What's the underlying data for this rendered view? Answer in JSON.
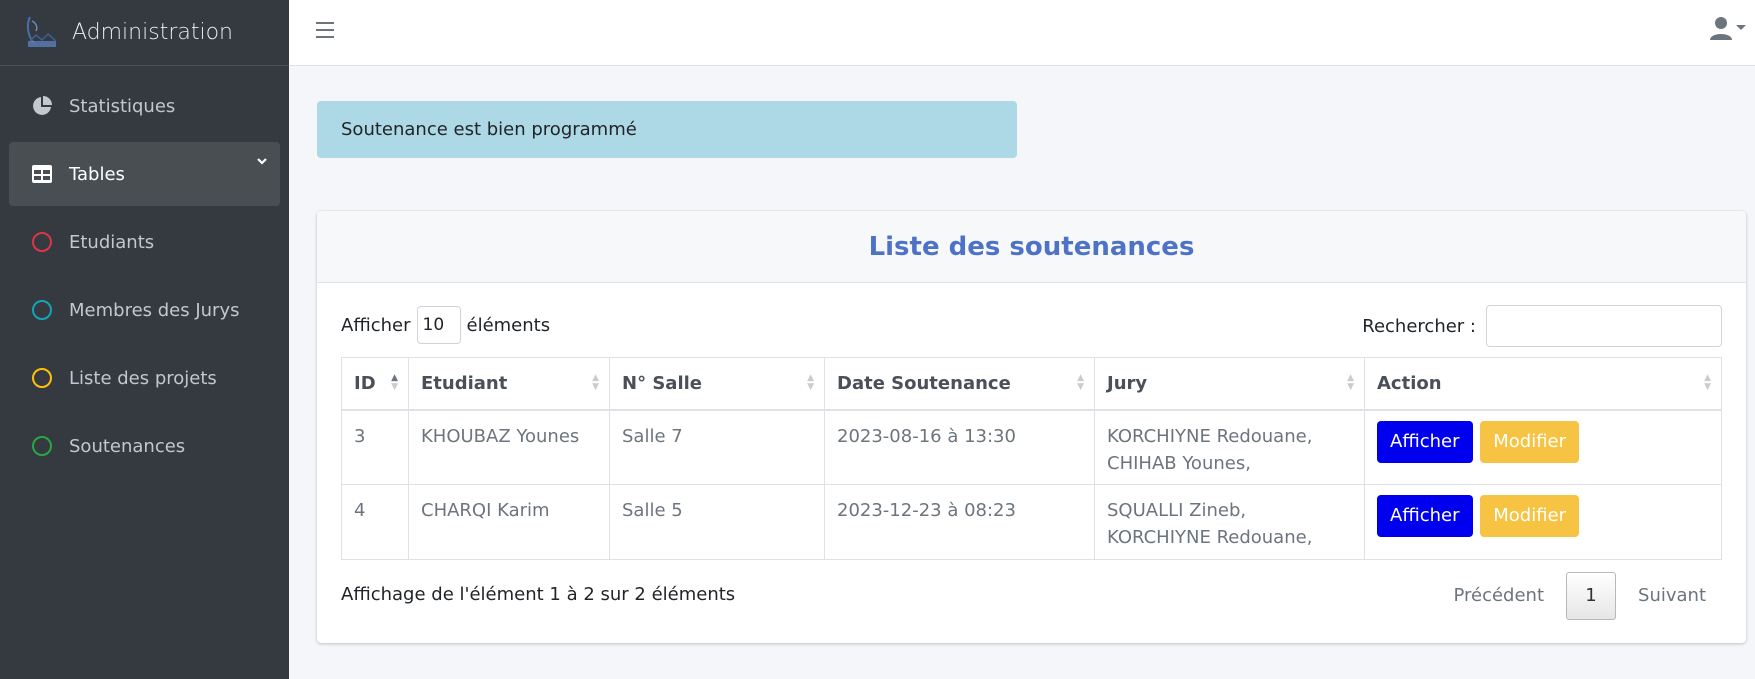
{
  "app": {
    "title": "Administration"
  },
  "sidebar": {
    "items": [
      {
        "label": "Statistiques",
        "icon": "pie-chart-icon"
      },
      {
        "label": "Tables",
        "icon": "table-icon",
        "active": true
      },
      {
        "label": "Etudiants",
        "icon": "circle-icon",
        "color": "#dc3545"
      },
      {
        "label": "Membres des Jurys",
        "icon": "circle-icon",
        "color": "#17a2b8"
      },
      {
        "label": "Liste des projets",
        "icon": "circle-icon",
        "color": "#ffc107"
      },
      {
        "label": "Soutenances",
        "icon": "circle-icon",
        "color": "#28a745"
      }
    ]
  },
  "alert": {
    "text": "Soutenance est bien programmé",
    "color": "#add8e6"
  },
  "card": {
    "title": "Liste des soutenances",
    "length": {
      "prefix": "Afficher",
      "value": "10",
      "suffix": "éléments"
    },
    "search": {
      "label": "Rechercher :",
      "value": ""
    },
    "columns": [
      "ID",
      "Etudiant",
      "N° Salle",
      "Date Soutenance",
      "Jury",
      "Action"
    ],
    "rows": [
      {
        "id": "3",
        "etudiant": "KHOUBAZ Younes",
        "salle": "Salle 7",
        "date": "2023-08-16 à 13:30",
        "jury1": "KORCHIYNE Redouane,",
        "jury2": "CHIHAB Younes,"
      },
      {
        "id": "4",
        "etudiant": "CHARQI Karim",
        "salle": "Salle 5",
        "date": "2023-12-23 à 08:23",
        "jury1": "SQUALLI Zineb,",
        "jury2": "KORCHIYNE Redouane,"
      }
    ],
    "buttons": {
      "show": "Afficher",
      "edit": "Modifier"
    },
    "info": "Affichage de l'élément 1 à 2 sur 2 éléments",
    "pager": {
      "prev": "Précédent",
      "current": "1",
      "next": "Suivant"
    }
  },
  "colors": {
    "sidebar": "#343a40",
    "title": "#4e73c6",
    "btn_show": "#0000ee",
    "btn_edit": "#f6c342"
  }
}
